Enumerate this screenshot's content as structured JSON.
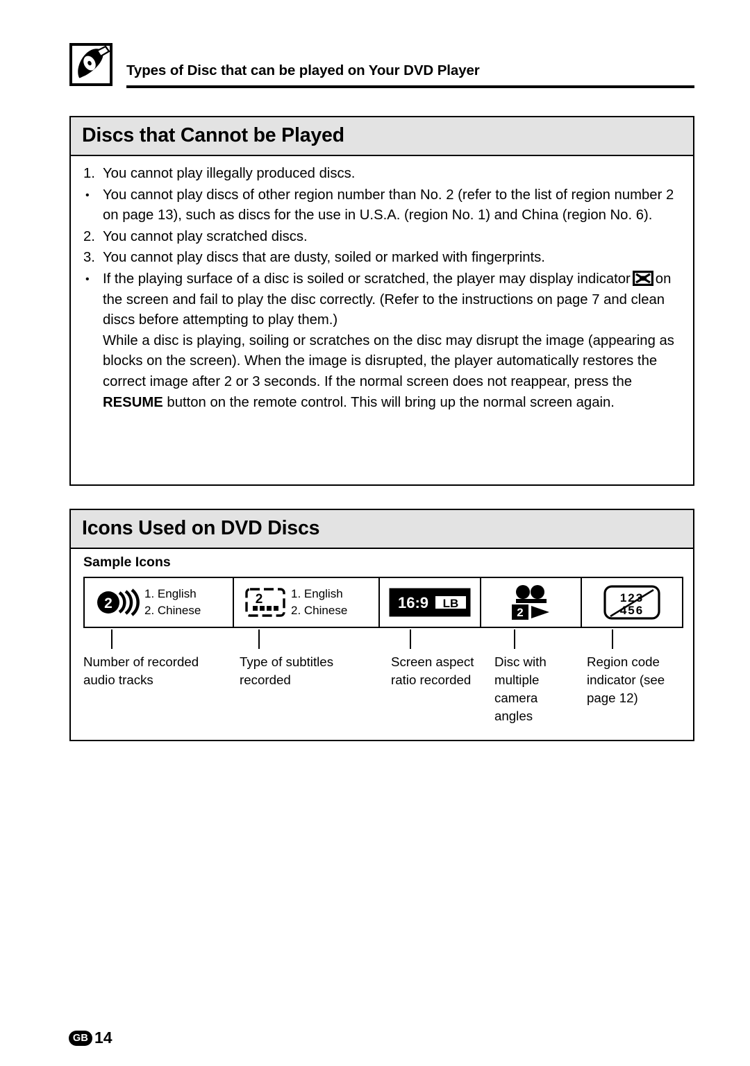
{
  "header": {
    "icon": "disc-pencil-icon",
    "title": "Types of Disc that can be played on Your DVD Player"
  },
  "section_cannot": {
    "heading": "Discs that Cannot be Played",
    "items": [
      {
        "mark": "1.",
        "text": "You cannot play illegally produced discs."
      },
      {
        "mark": "•",
        "text": "You cannot play discs of other region number than No. 2 (refer to the list of region number 2 on page 13), such as discs for the use in U.S.A. (region No. 1) and China (region No. 6)."
      },
      {
        "mark": "2.",
        "text": "You cannot play scratched discs."
      },
      {
        "mark": "3.",
        "text": "You cannot play discs that are dusty, soiled or marked with fingerprints."
      }
    ],
    "last_item": {
      "mark": "•",
      "part1": "If the playing surface of a disc is soiled or scratched, the player may display indicator",
      "part2": "on the screen and fail to play the disc correctly. (Refer to the instructions on page 7 and clean discs before attempting to play them.)",
      "part3_a": "While a disc is playing, soiling or scratches on the disc may disrupt the image (appearing as blocks on the screen). When the image is disrupted, the player automatically restores the correct image after 2 or 3 seconds. If the normal screen does not reappear, press the ",
      "part3_bold": "RESUME",
      "part3_b": " button on the remote control. This will bring up the normal screen again."
    }
  },
  "section_icons": {
    "heading": "Icons Used on DVD Discs",
    "sample_title": "Sample Icons",
    "cells": [
      {
        "icon": "audio-tracks-icon",
        "number": "2",
        "lang1": "1. English",
        "lang2": "2. Chinese",
        "caption": "Number of recorded audio tracks"
      },
      {
        "icon": "subtitle-icon",
        "number": "2",
        "lang1": "1. English",
        "lang2": "2. Chinese",
        "caption": "Type of subtitles recorded"
      },
      {
        "icon": "aspect-ratio-icon",
        "ratio": "16:9",
        "lb": "LB",
        "caption": "Screen aspect ratio recorded"
      },
      {
        "icon": "camera-angle-icon",
        "number": "2",
        "caption": "Disc with multiple camera angles"
      },
      {
        "icon": "region-code-icon",
        "digits": "123456",
        "caption": "Region code indicator (see page 12)"
      }
    ]
  },
  "footer": {
    "badge": "GB",
    "page": "14"
  }
}
